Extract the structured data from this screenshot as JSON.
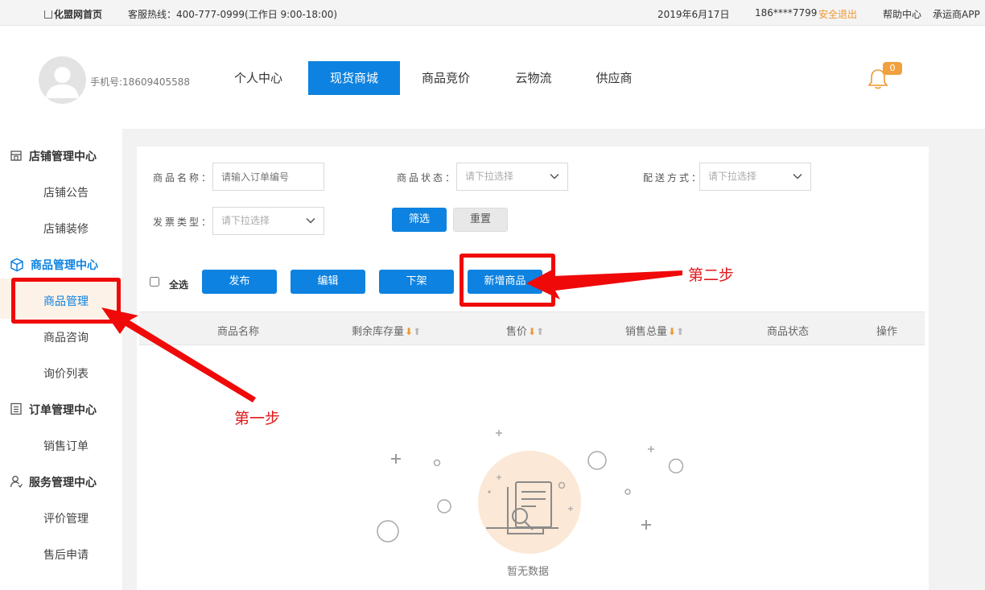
{
  "topbar": {
    "home": "化盟网首页",
    "hotline": "客服热线：400-777-0999(工作日 9:00-18:00)",
    "date": "2019年6月17日",
    "user": "186****7799",
    "logout": "安全退出",
    "help": "帮助中心",
    "app": "承运商APP"
  },
  "header": {
    "phone": "手机号:18609405588",
    "nav": [
      "个人中心",
      "现货商城",
      "商品竞价",
      "云物流",
      "供应商"
    ],
    "active_nav": "现货商城",
    "bell_count": "0"
  },
  "sidebar": {
    "store": {
      "title": "店铺管理中心",
      "items": [
        "店铺公告",
        "店铺装修"
      ]
    },
    "goods": {
      "title": "商品管理中心",
      "items": [
        "商品管理",
        "商品咨询",
        "询价列表"
      ]
    },
    "orders": {
      "title": "订单管理中心",
      "items": [
        "销售订单"
      ]
    },
    "service": {
      "title": "服务管理中心",
      "items": [
        "评价管理",
        "售后申请"
      ]
    }
  },
  "filters": {
    "name_label": "商品名称：",
    "name_placeholder": "请输入订单编号",
    "status_label": "商品状态：",
    "status_value": "请下拉选择",
    "delivery_label": "配送方式：",
    "delivery_value": "请下拉选择",
    "invoice_label": "发票类型：",
    "invoice_value": "请下拉选择",
    "filter_btn": "筛选",
    "reset_btn": "重置"
  },
  "actions": {
    "select_all": "全选",
    "publish": "发布",
    "edit": "编辑",
    "unlist": "下架",
    "add": "新增商品"
  },
  "table": {
    "columns": [
      "商品名称",
      "剩余库存量",
      "售价",
      "销售总量",
      "商品状态",
      "操作"
    ]
  },
  "empty": {
    "text": "暂无数据"
  },
  "annotations": {
    "step1": "第一步",
    "step2": "第二步"
  },
  "colors": {
    "primary": "#0d82e0",
    "accent_orange": "#f0962f",
    "annotation_red": "#f00909"
  }
}
